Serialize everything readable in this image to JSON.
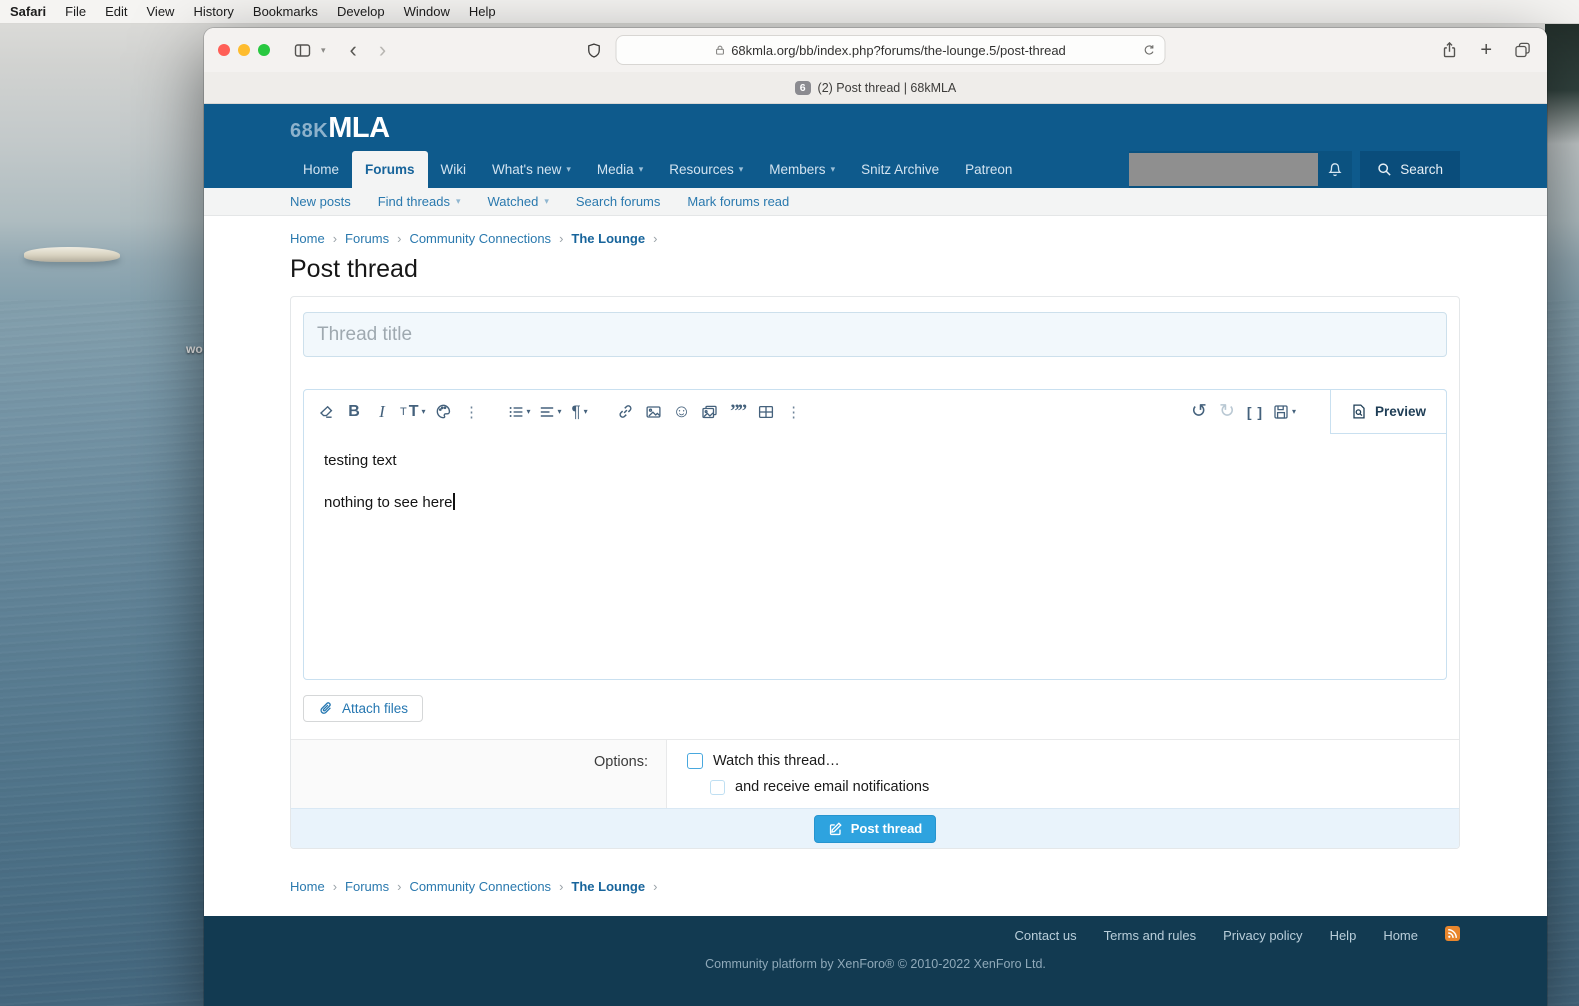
{
  "menubar": {
    "items": [
      "Safari",
      "File",
      "Edit",
      "View",
      "History",
      "Bookmarks",
      "Develop",
      "Window",
      "Help"
    ]
  },
  "desktop": {
    "icon_label": "wo"
  },
  "browser": {
    "url": "68kmla.org/bb/index.php?forums/the-lounge.5/post-thread",
    "tab_badge": "6",
    "tab_title": "(2) Post thread | 68kMLA"
  },
  "header": {
    "logo_prefix": "68K",
    "logo_suffix": "MLA",
    "nav": {
      "items": [
        {
          "label": "Home"
        },
        {
          "label": "Forums"
        },
        {
          "label": "Wiki"
        },
        {
          "label": "What's new"
        },
        {
          "label": "Media"
        },
        {
          "label": "Resources"
        },
        {
          "label": "Members"
        },
        {
          "label": "Snitz Archive"
        },
        {
          "label": "Patreon"
        }
      ]
    },
    "search_label": "Search"
  },
  "subnav": {
    "items": [
      {
        "label": "New posts"
      },
      {
        "label": "Find threads"
      },
      {
        "label": "Watched"
      },
      {
        "label": "Search forums"
      },
      {
        "label": "Mark forums read"
      }
    ]
  },
  "breadcrumb": {
    "items": [
      "Home",
      "Forums",
      "Community Connections",
      "The Lounge"
    ]
  },
  "page": {
    "title": "Post thread"
  },
  "form": {
    "title_placeholder": "Thread title",
    "toolbar": {
      "bold": "B",
      "italic": "I",
      "size_small": "T",
      "size_large": "T",
      "pilcrow": "¶",
      "dots": "⋮",
      "undo": "↺",
      "redo": "↻",
      "brackets": "[ ]",
      "quote": "””",
      "smiley": "☺",
      "preview_label": "Preview"
    },
    "editor_lines": [
      "testing text",
      "nothing to see here"
    ],
    "attach_label": "Attach files",
    "options_label": "Options:",
    "watch_label": "Watch this thread…",
    "email_label": "and receive email notifications",
    "submit_label": "Post thread"
  },
  "footer": {
    "links": [
      "Contact us",
      "Terms and rules",
      "Privacy policy",
      "Help",
      "Home"
    ],
    "copyright": "Community platform by XenForo® © 2010-2022 XenForo Ltd."
  },
  "colors": {
    "header_blue": "#0e5a8c",
    "accent_blue": "#2577b1",
    "button_blue": "#2ea3df",
    "footer_navy": "#123a51",
    "rss_orange": "#e8862d"
  }
}
